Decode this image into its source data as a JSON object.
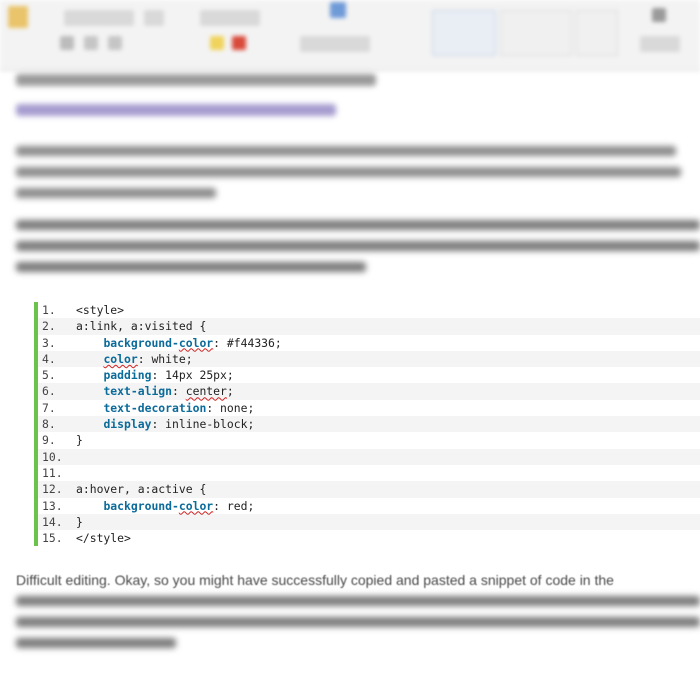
{
  "code": {
    "lines": [
      {
        "num": "1.",
        "indent": "",
        "prop": "",
        "prop_squig": "",
        "rest": "<style>"
      },
      {
        "num": "2.",
        "indent": "",
        "prop": "",
        "prop_squig": "",
        "rest": "a:link, a:visited {"
      },
      {
        "num": "3.",
        "indent": "    ",
        "prop": "background-",
        "prop_squig": "color",
        "rest": ": #f44336;"
      },
      {
        "num": "4.",
        "indent": "    ",
        "prop": "",
        "prop_squig": "color",
        "rest": ": white;"
      },
      {
        "num": "5.",
        "indent": "    ",
        "prop": "padding",
        "prop_squig": "",
        "rest": ": 14px 25px;"
      },
      {
        "num": "6.",
        "indent": "    ",
        "prop": "text-align",
        "prop_squig": "",
        "rest": ": ",
        "value_squig": "center",
        "tail": ";"
      },
      {
        "num": "7.",
        "indent": "    ",
        "prop": "text-decoration",
        "prop_squig": "",
        "rest": ": none;"
      },
      {
        "num": "8.",
        "indent": "    ",
        "prop": "display",
        "prop_squig": "",
        "rest": ": inline-block;"
      },
      {
        "num": "9.",
        "indent": "",
        "prop": "",
        "prop_squig": "",
        "rest": "}"
      },
      {
        "num": "10.",
        "indent": "",
        "prop": "",
        "prop_squig": "",
        "rest": ""
      },
      {
        "num": "11.",
        "indent": "",
        "prop": "",
        "prop_squig": "",
        "rest": ""
      },
      {
        "num": "12.",
        "indent": "",
        "prop": "",
        "prop_squig": "",
        "rest": "a:hover, a:active {"
      },
      {
        "num": "13.",
        "indent": "    ",
        "prop": "background-",
        "prop_squig": "color",
        "rest": ": red;"
      },
      {
        "num": "14.",
        "indent": "",
        "prop": "",
        "prop_squig": "",
        "rest": "}"
      },
      {
        "num": "15.",
        "indent": "",
        "prop": "",
        "prop_squig": "",
        "rest": "</style>"
      }
    ]
  },
  "bottom": {
    "sharp": "Difficult editing. Okay, so you might have successfully copied and pasted a snippet of code in the"
  },
  "colors": {
    "code_border": "#6cc24a",
    "keyword": "#0b6b9a",
    "squiggle": "#d02020"
  }
}
